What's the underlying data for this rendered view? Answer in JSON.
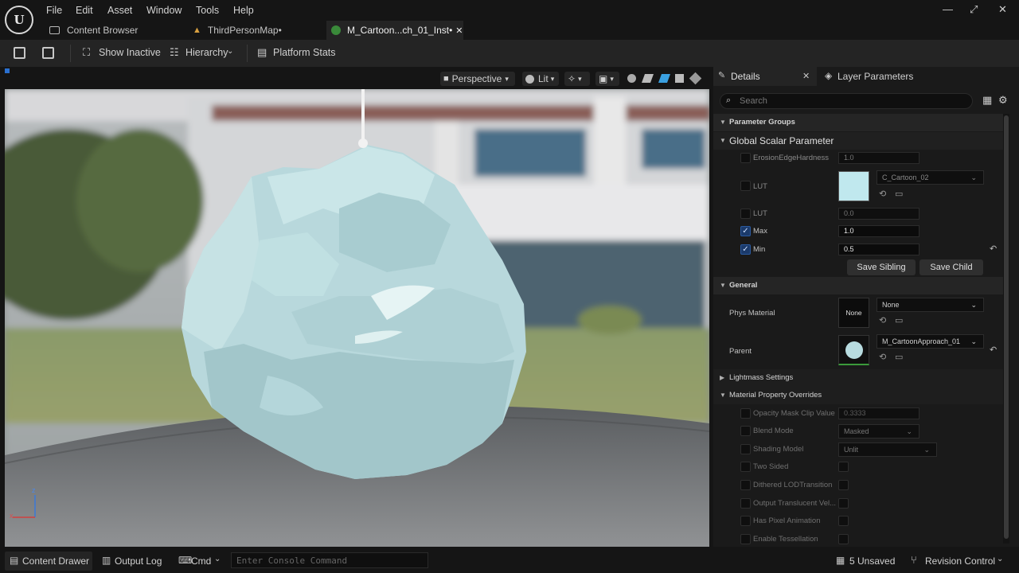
{
  "menu": [
    "File",
    "Edit",
    "Asset",
    "Window",
    "Tools",
    "Help"
  ],
  "tabs": [
    {
      "label": "Content Browser"
    },
    {
      "label": "ThirdPersonMap•"
    },
    {
      "label": "M_Cartoon...ch_01_Inst•"
    }
  ],
  "toolbar": {
    "show_inactive": "Show Inactive",
    "hierarchy": "Hierarchy",
    "platform_stats": "Platform Stats"
  },
  "viewport": {
    "perspective": "Perspective",
    "lit": "Lit",
    "axis_x": "x",
    "axis_z": "z"
  },
  "details": {
    "tab_details": "Details",
    "tab_layer": "Layer Parameters",
    "search_placeholder": "Search",
    "parameter_groups": "Parameter Groups",
    "global_scalar": "Global Scalar Parameter",
    "erosion_label": "ErosionEdgeHardness",
    "erosion_value": "1.0",
    "lut_label": "LUT",
    "lut_texture": "C_Cartoon_02",
    "lut2_label": "LUT",
    "lut2_value": "0.0",
    "max_label": "Max",
    "max_value": "1.0",
    "min_label": "Min",
    "min_value": "0.5",
    "save_sibling": "Save Sibling",
    "save_child": "Save Child",
    "general": "General",
    "phys_label": "Phys Material",
    "phys_thumb": "None",
    "phys_value": "None",
    "parent_label": "Parent",
    "parent_value": "M_CartoonApproach_01",
    "lightmass": "Lightmass Settings",
    "overrides": "Material Property Overrides",
    "opacity_label": "Opacity Mask Clip Value",
    "opacity_value": "0.3333",
    "blend_label": "Blend Mode",
    "blend_value": "Masked",
    "shading_label": "Shading Model",
    "shading_value": "Unlit",
    "two_sided": "Two Sided",
    "dithered": "Dithered LODTransition",
    "output_translucent": "Output Translucent Vel...",
    "pixel_anim": "Has Pixel Animation",
    "tessellation": "Enable Tessellation"
  },
  "status": {
    "content_drawer": "Content Drawer",
    "output_log": "Output Log",
    "cmd": "Cmd",
    "console_placeholder": "Enter Console Command",
    "unsaved": "5 Unsaved",
    "revision": "Revision Control"
  }
}
